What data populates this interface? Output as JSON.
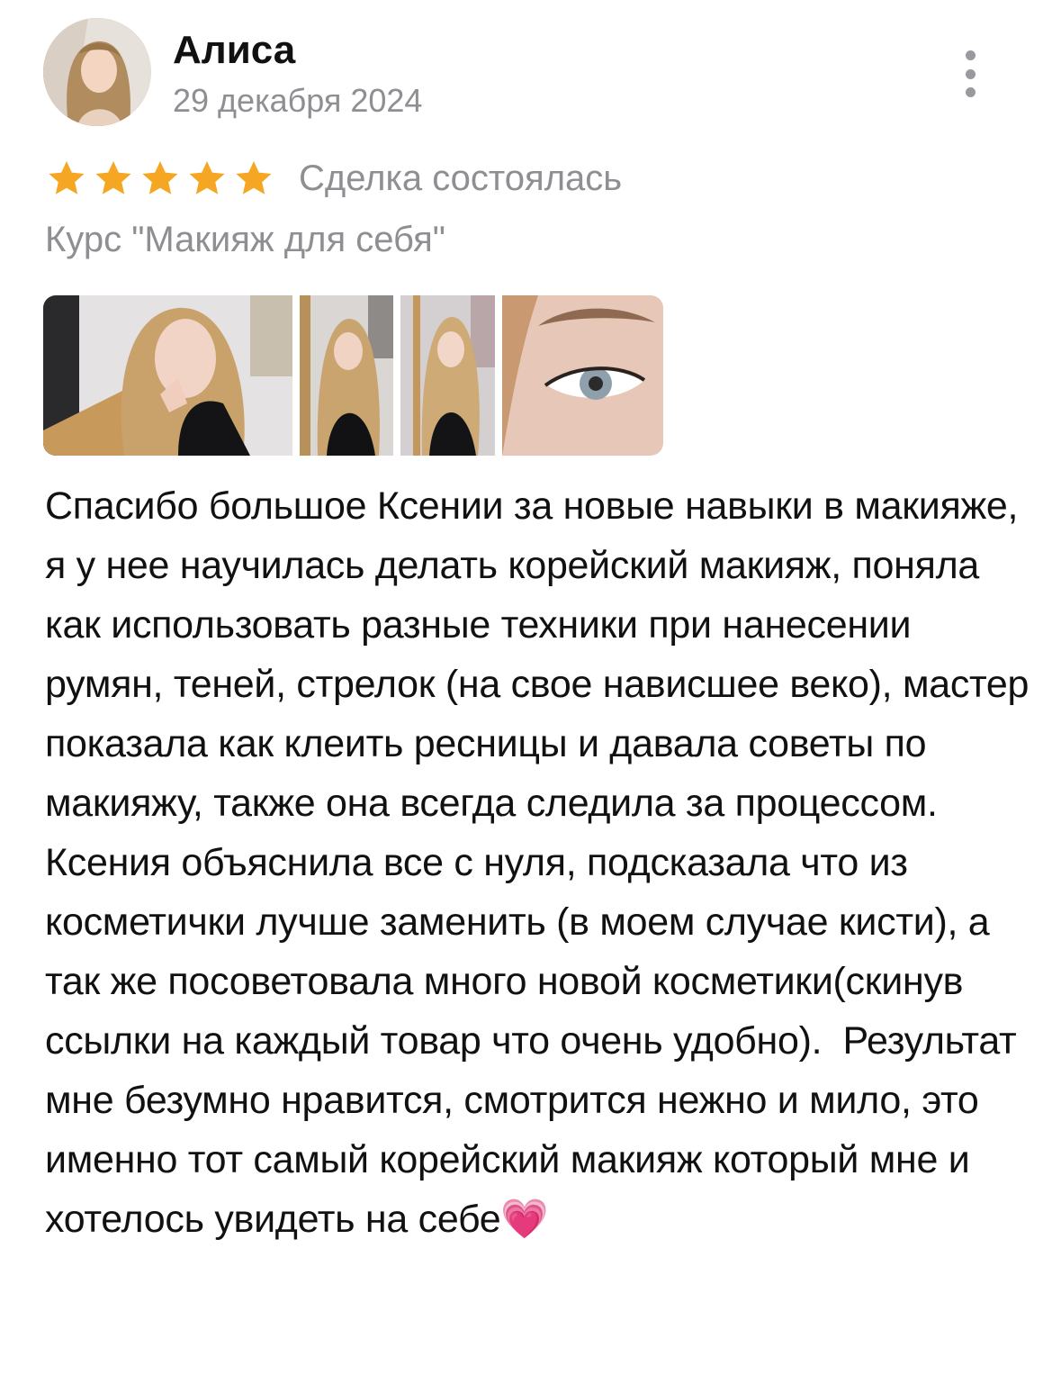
{
  "review": {
    "author": "Алиса",
    "date": "29 декабря 2024",
    "rating": 5,
    "rating_max": 5,
    "star_color": "#F5A623",
    "deal_status": "Сделка состоялась",
    "course": "Курс \"Макияж для себя\"",
    "photos": [
      {
        "subject": "selfie-hand-near-face"
      },
      {
        "subject": "mirror-selfie"
      },
      {
        "subject": "mirror-selfie-closed-eyes"
      },
      {
        "subject": "eye-closeup"
      }
    ],
    "text": "Спасибо большое Ксении за новые навыки в макияже, я у нее научилась делать корейский макияж, поняла как использовать разные техники при нанесении румян, теней, стрелок (на свое нависшее веко), мастер показала как клеить ресницы и давала советы по макияжу, также она всегда следила за процессом. Ксения объяснила все с нуля, подсказала что из косметички лучше заменить (в моем случае кисти), а так же посоветовала много новой косметики(скинув ссылки на каждый товар что очень удобно).  Результат мне безумно нравится, смотрится нежно и мило, это именно тот самый корейский макияж который мне и хотелось увидеть на себе💗"
  },
  "icons": {
    "more": "more-vertical-icon",
    "star": "star-icon",
    "heart": "pink-heart-emoji"
  }
}
